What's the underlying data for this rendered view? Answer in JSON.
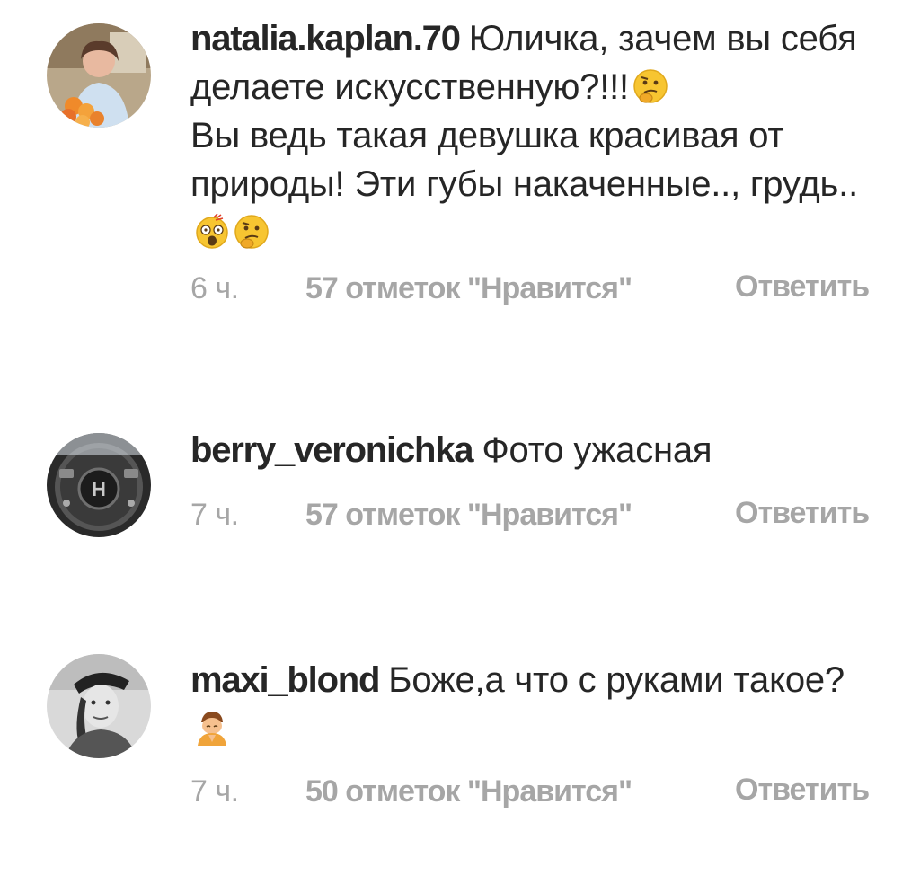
{
  "comments": [
    {
      "username": "natalia.kaplan.70",
      "text": "Юличка, зачем вы себя делаете искусственную?!!!",
      "text2": "Вы ведь такая девушка красивая от природы! Эти губы накаченные.., грудь..",
      "time": "6 ч.",
      "likes": "57 отметок \"Нравится\"",
      "reply": "Ответить",
      "emojis": [
        "thinking-face",
        "astonished-face",
        "thinking-face"
      ]
    },
    {
      "username": "berry_veronichka",
      "text": "Фото ужасная",
      "time": "7 ч.",
      "likes": "57 отметок \"Нравится\"",
      "reply": "Ответить"
    },
    {
      "username": "maxi_blond",
      "text": "Боже,а что с руками такое?",
      "time": "7 ч.",
      "likes": "50 отметок \"Нравится\"",
      "reply": "Ответить",
      "emojis": [
        "person-bowing"
      ]
    }
  ],
  "colors": {
    "text": "#262626",
    "meta": "#a6a6a6",
    "background": "#ffffff"
  }
}
